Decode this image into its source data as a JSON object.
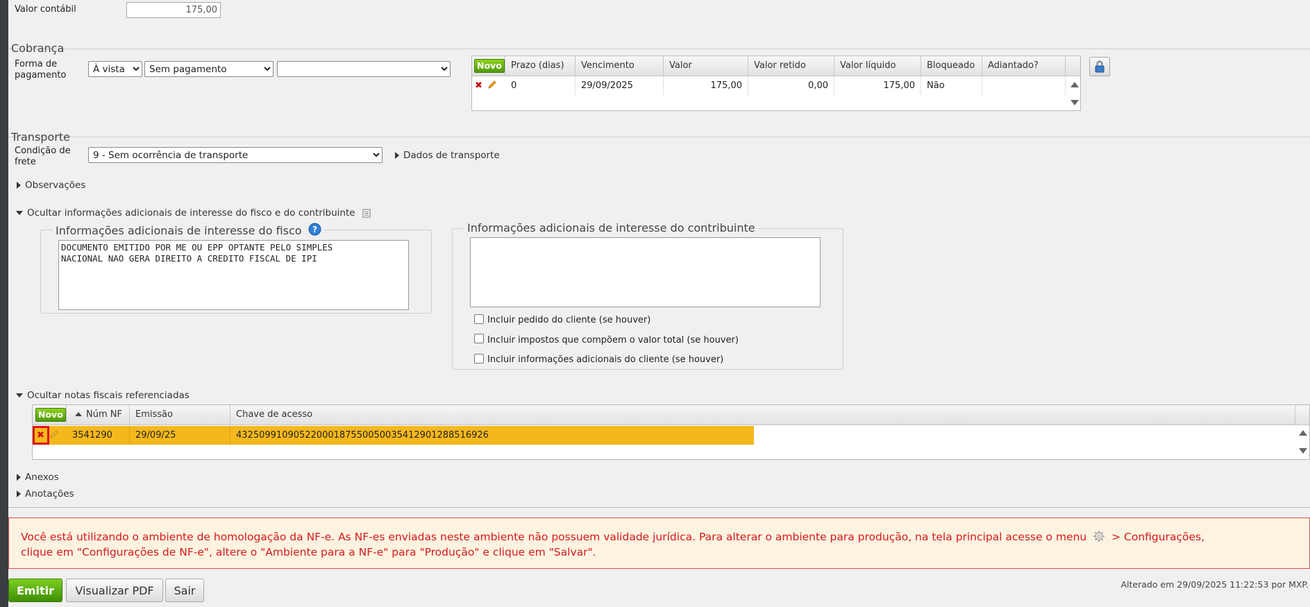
{
  "valor_contabil": {
    "label": "Valor contábil",
    "value": "175,00"
  },
  "cobranca": {
    "title": "Cobrança",
    "forma_label": "Forma de pagamento",
    "selects": [
      "À vista",
      "Sem pagamento",
      ""
    ],
    "novo_label": "Novo",
    "grid_headers": [
      "Prazo (dias)",
      "Vencimento",
      "Valor",
      "Valor retido",
      "Valor líquido",
      "Bloqueado",
      "Adiantado?"
    ],
    "rows": [
      {
        "prazo": "0",
        "vencimento": "29/09/2025",
        "valor": "175,00",
        "retido": "0,00",
        "liquido": "175,00",
        "bloqueado": "Não",
        "adiantado": ""
      }
    ]
  },
  "transporte": {
    "title": "Transporte",
    "condicao_label": "Condição de frete",
    "condicao_value": "9 - Sem ocorrência de transporte",
    "dados_link": "Dados de transporte"
  },
  "observacoes_toggle": "Observações",
  "info_toggle": "Ocultar informações adicionais de interesse do fisco e do contribuinte",
  "fisco": {
    "legend": "Informações adicionais de interesse do fisco",
    "text": "DOCUMENTO EMITIDO POR ME OU EPP OPTANTE PELO SIMPLES\nNACIONAL NAO GERA DIREITO A CREDITO FISCAL DE IPI"
  },
  "contribuinte": {
    "legend": "Informações adicionais de interesse do contribuinte",
    "text": "",
    "checks": [
      "Incluir pedido do cliente (se houver)",
      "Incluir impostos que compõem o valor total (se houver)",
      "Incluir informações adicionais do cliente (se houver)"
    ]
  },
  "notas_toggle": "Ocultar notas fiscais referenciadas",
  "notas": {
    "novo_label": "Novo",
    "headers": [
      "Núm NF",
      "Emissão",
      "Chave de acesso"
    ],
    "rows": [
      {
        "num": "3541290",
        "emissao": "29/09/25",
        "chave": "43250991090522000187550050035412901288516926"
      }
    ]
  },
  "anexos_toggle": "Anexos",
  "anotacoes_toggle": "Anotações",
  "warning": {
    "part1": "Você está utilizando o ambiente de homologação da NF-e. As NF-es enviadas neste ambiente não possuem validade jurídica. Para alterar o ambiente para produção, na tela principal acesse o menu",
    "part2": "> Configurações,",
    "line2": "clique em \"Configurações de NF-e\", altere o \"Ambiente para a NF-e\" para \"Produção\" e clique em \"Salvar\"."
  },
  "buttons": {
    "emitir": "Emitir",
    "pdf": "Visualizar PDF",
    "sair": "Sair"
  },
  "footer_status": "Alterado em 29/09/2025 11:22:53 por MXP."
}
